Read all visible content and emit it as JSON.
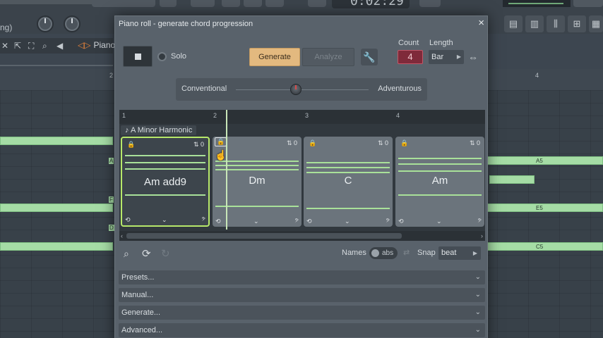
{
  "background": {
    "left_text": "ng)",
    "time": "0:02:29",
    "piano_label": "Piano",
    "ruler_numbers": [
      "2",
      "4"
    ],
    "note_labels": [
      "A5",
      "E5",
      "C5"
    ],
    "left_markers": [
      "A",
      "F",
      "D"
    ]
  },
  "dialog": {
    "title": "Piano roll - generate chord progression",
    "close": "×",
    "solo_label": "Solo",
    "generate_label": "Generate",
    "analyze_label": "Analyze",
    "count": {
      "label": "Count",
      "value": "4"
    },
    "length": {
      "label": "Length",
      "value": "Bar"
    },
    "slider": {
      "left_label": "Conventional",
      "right_label": "Adventurous",
      "value": 0.45
    },
    "progression": {
      "ruler": [
        "1",
        "2",
        "3",
        "4"
      ],
      "scale": "A Minor Harmonic",
      "chords": [
        {
          "name": "Am add9",
          "count": "0",
          "selected": true
        },
        {
          "name": "Dm",
          "count": "0",
          "selected": false
        },
        {
          "name": "C",
          "count": "0",
          "selected": false
        },
        {
          "name": "Am",
          "count": "0",
          "selected": false
        }
      ]
    },
    "names_label": "Names",
    "names_mode": "abs",
    "snap": {
      "label": "Snap",
      "value": "beat"
    },
    "sections": [
      "Presets...",
      "Manual...",
      "Generate...",
      "Advanced..."
    ]
  },
  "colors": {
    "accent_generate": "#e3b97f",
    "count_bg": "#7f2a3a",
    "selected_outline": "#b7e86a",
    "note_green": "#a5dca5"
  }
}
